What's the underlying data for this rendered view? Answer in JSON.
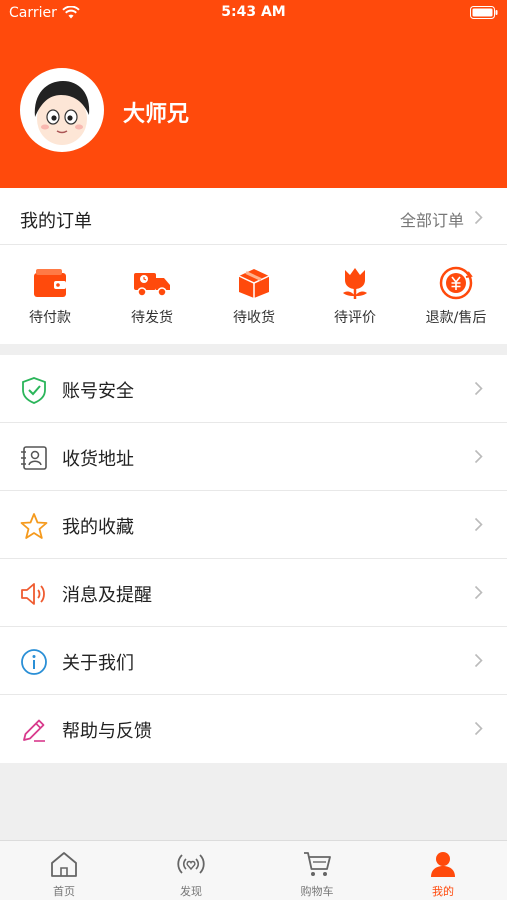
{
  "status_bar": {
    "carrier": "Carrier",
    "time": "5:43 AM"
  },
  "profile": {
    "name": "大师兄"
  },
  "orders": {
    "title": "我的订单",
    "all_label": "全部订单",
    "items": [
      {
        "label": "待付款",
        "icon": "wallet-icon"
      },
      {
        "label": "待发货",
        "icon": "truck-icon"
      },
      {
        "label": "待收货",
        "icon": "package-icon"
      },
      {
        "label": "待评价",
        "icon": "tulip-icon"
      },
      {
        "label": "退款/售后",
        "icon": "refund-icon"
      }
    ]
  },
  "menu": [
    {
      "label": "账号安全",
      "icon": "shield-check-icon"
    },
    {
      "label": "收货地址",
      "icon": "address-card-icon"
    },
    {
      "label": "我的收藏",
      "icon": "star-icon"
    },
    {
      "label": "消息及提醒",
      "icon": "speaker-icon"
    },
    {
      "label": "关于我们",
      "icon": "info-icon"
    },
    {
      "label": "帮助与反馈",
      "icon": "pencil-icon"
    }
  ],
  "tabbar": {
    "items": [
      {
        "label": "首页",
        "icon": "home-icon"
      },
      {
        "label": "发现",
        "icon": "discover-icon"
      },
      {
        "label": "购物车",
        "icon": "cart-icon"
      },
      {
        "label": "我的",
        "icon": "user-icon",
        "active": true
      }
    ]
  },
  "colors": {
    "accent": "#ff4a0c",
    "background": "#efefef"
  }
}
